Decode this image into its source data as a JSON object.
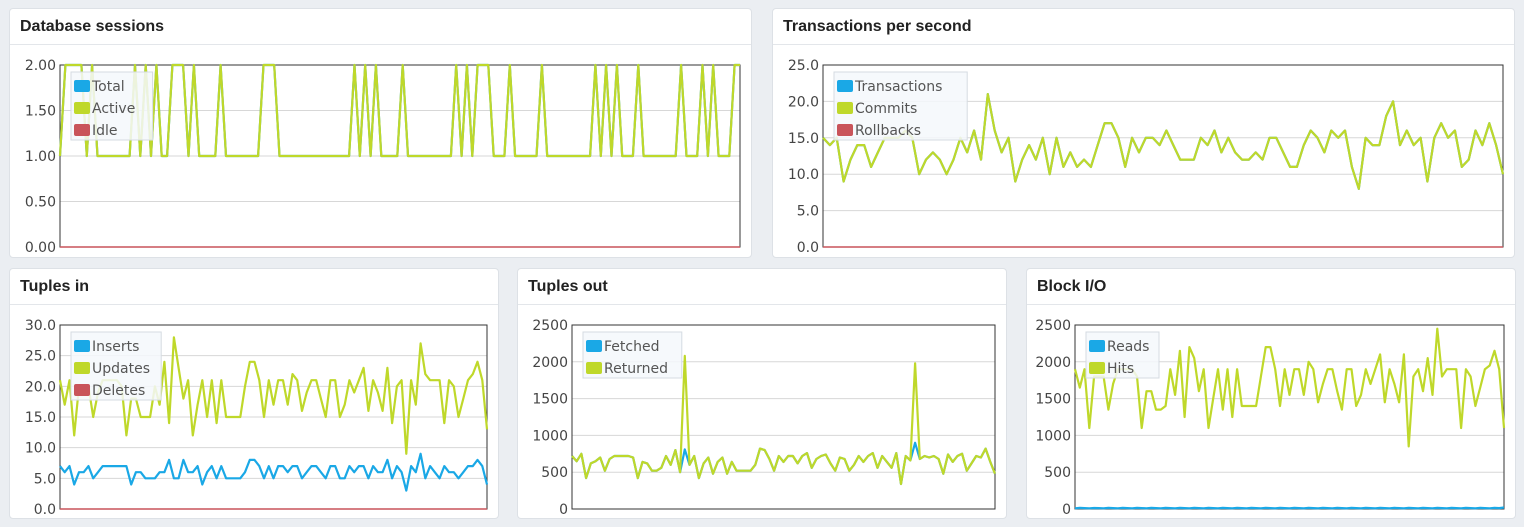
{
  "colors": {
    "blue": "#1aa8e6",
    "green": "#bfd82a",
    "red": "#c9545a",
    "grid": "#d7d7d7"
  },
  "chart_data": [
    {
      "id": "sessions",
      "type": "line",
      "title": "Database sessions",
      "ylim": [
        0,
        2
      ],
      "yticks": [
        "0.00",
        "0.50",
        "1.00",
        "1.50",
        "2.00"
      ],
      "ytick_values": [
        0,
        0.5,
        1,
        1.5,
        2
      ],
      "legend": "top-left",
      "grid": true,
      "series": [
        {
          "name": "Total",
          "color": "blue",
          "values": [
            1,
            2,
            2,
            2,
            2,
            1,
            2,
            1,
            1,
            1,
            1,
            1,
            1,
            1,
            2,
            1,
            2,
            1,
            2,
            1,
            1,
            2,
            2,
            2,
            1,
            2,
            1,
            1,
            1,
            1,
            2,
            1,
            1,
            1,
            1,
            1,
            1,
            1,
            2,
            2,
            2,
            1,
            1,
            1,
            1,
            1,
            1,
            1,
            1,
            1,
            1,
            1,
            1,
            1,
            1,
            2,
            1,
            2,
            1,
            2,
            1,
            1,
            1,
            1,
            2,
            1,
            1,
            1,
            1,
            1,
            1,
            1,
            1,
            1,
            2,
            1,
            2,
            1,
            2,
            2,
            2,
            1,
            1,
            1,
            2,
            1,
            1,
            1,
            1,
            1,
            2,
            1,
            1,
            1,
            1,
            1,
            1,
            1,
            1,
            1,
            2,
            1,
            2,
            1,
            2,
            1,
            1,
            1,
            2,
            1,
            1,
            1,
            1,
            1,
            1,
            1,
            2,
            1,
            1,
            1,
            2,
            1,
            2,
            1,
            1,
            1,
            2,
            2
          ]
        },
        {
          "name": "Active",
          "color": "green",
          "values": [
            1,
            2,
            2,
            2,
            2,
            1,
            2,
            1,
            1,
            1,
            1,
            1,
            1,
            1,
            2,
            1,
            2,
            1,
            2,
            1,
            1,
            2,
            2,
            2,
            1,
            2,
            1,
            1,
            1,
            1,
            2,
            1,
            1,
            1,
            1,
            1,
            1,
            1,
            2,
            2,
            2,
            1,
            1,
            1,
            1,
            1,
            1,
            1,
            1,
            1,
            1,
            1,
            1,
            1,
            1,
            2,
            1,
            2,
            1,
            2,
            1,
            1,
            1,
            1,
            2,
            1,
            1,
            1,
            1,
            1,
            1,
            1,
            1,
            1,
            2,
            1,
            2,
            1,
            2,
            2,
            2,
            1,
            1,
            1,
            2,
            1,
            1,
            1,
            1,
            1,
            2,
            1,
            1,
            1,
            1,
            1,
            1,
            1,
            1,
            1,
            2,
            1,
            2,
            1,
            2,
            1,
            1,
            1,
            2,
            1,
            1,
            1,
            1,
            1,
            1,
            1,
            2,
            1,
            1,
            1,
            2,
            1,
            2,
            1,
            1,
            1,
            2,
            2
          ]
        },
        {
          "name": "Idle",
          "color": "red",
          "values": [
            0,
            0
          ]
        }
      ]
    },
    {
      "id": "tps",
      "type": "line",
      "title": "Transactions per second",
      "ylim": [
        0,
        25
      ],
      "yticks": [
        "0.0",
        "5.0",
        "10.0",
        "15.0",
        "20.0",
        "25.0"
      ],
      "ytick_values": [
        0,
        5,
        10,
        15,
        20,
        25
      ],
      "legend": "top-left",
      "grid": true,
      "series": [
        {
          "name": "Transactions",
          "color": "blue",
          "values": [
            15,
            14,
            15,
            9,
            12,
            14,
            14,
            11,
            13,
            15,
            15,
            15,
            16,
            15,
            10,
            12,
            13,
            12,
            10,
            12,
            15,
            13,
            16,
            12,
            21,
            16,
            13,
            15,
            9,
            12,
            14,
            12,
            15,
            10,
            15,
            11,
            13,
            11,
            12,
            11,
            14,
            17,
            17,
            15,
            11,
            15,
            13,
            15,
            15,
            14,
            16,
            14,
            12,
            12,
            12,
            15,
            14,
            16,
            13,
            15,
            13,
            12,
            12,
            13,
            12,
            15,
            15,
            13,
            11,
            11,
            14,
            16,
            15,
            13,
            16,
            15,
            16,
            11,
            8,
            15,
            14,
            14,
            18,
            20,
            14,
            16,
            14,
            15,
            9,
            15,
            17,
            15,
            16,
            11,
            12,
            16,
            14,
            17,
            14,
            10
          ]
        },
        {
          "name": "Commits",
          "color": "green",
          "values": [
            15,
            14,
            15,
            9,
            12,
            14,
            14,
            11,
            13,
            15,
            15,
            15,
            16,
            15,
            10,
            12,
            13,
            12,
            10,
            12,
            15,
            13,
            16,
            12,
            21,
            16,
            13,
            15,
            9,
            12,
            14,
            12,
            15,
            10,
            15,
            11,
            13,
            11,
            12,
            11,
            14,
            17,
            17,
            15,
            11,
            15,
            13,
            15,
            15,
            14,
            16,
            14,
            12,
            12,
            12,
            15,
            14,
            16,
            13,
            15,
            13,
            12,
            12,
            13,
            12,
            15,
            15,
            13,
            11,
            11,
            14,
            16,
            15,
            13,
            16,
            15,
            16,
            11,
            8,
            15,
            14,
            14,
            18,
            20,
            14,
            16,
            14,
            15,
            9,
            15,
            17,
            15,
            16,
            11,
            12,
            16,
            14,
            17,
            14,
            10
          ]
        },
        {
          "name": "Rollbacks",
          "color": "red",
          "values": [
            0,
            0
          ]
        }
      ]
    },
    {
      "id": "tuplesin",
      "type": "line",
      "title": "Tuples in",
      "ylim": [
        0,
        30
      ],
      "yticks": [
        "0.0",
        "5.0",
        "10.0",
        "15.0",
        "20.0",
        "25.0",
        "30.0"
      ],
      "ytick_values": [
        0,
        5,
        10,
        15,
        20,
        25,
        30
      ],
      "legend": "top-left",
      "grid": true,
      "series": [
        {
          "name": "Inserts",
          "color": "blue",
          "values": [
            7,
            6,
            7,
            4,
            6,
            6,
            7,
            5,
            6,
            7,
            7,
            7,
            7,
            7,
            7,
            4,
            6,
            6,
            5,
            5,
            5,
            6,
            6,
            8,
            5,
            5,
            8,
            6,
            6,
            7,
            4,
            6,
            7,
            5,
            7,
            5,
            5,
            5,
            5,
            6,
            8,
            8,
            7,
            5,
            7,
            5,
            7,
            7,
            6,
            7,
            7,
            5,
            6,
            7,
            7,
            6,
            5,
            7,
            7,
            5,
            5,
            7,
            6,
            7,
            7,
            5,
            7,
            6,
            6,
            8,
            5,
            7,
            6,
            3,
            7,
            6,
            9,
            5,
            7,
            6,
            5,
            7,
            6,
            6,
            5,
            6,
            7,
            7,
            8,
            7,
            4
          ]
        },
        {
          "name": "Updates",
          "color": "green",
          "values": [
            21,
            17,
            21,
            12,
            20,
            20,
            20,
            15,
            19,
            21,
            21,
            21,
            21,
            20,
            12,
            18,
            18,
            15,
            15,
            15,
            20,
            17,
            24,
            14,
            28,
            23,
            18,
            21,
            12,
            17,
            21,
            15,
            21,
            14,
            21,
            15,
            15,
            15,
            15,
            20,
            24,
            24,
            21,
            15,
            21,
            17,
            21,
            21,
            17,
            22,
            21,
            16,
            19,
            21,
            21,
            18,
            15,
            21,
            21,
            15,
            17,
            21,
            19,
            21,
            23,
            16,
            21,
            19,
            16,
            23,
            14,
            20,
            21,
            9,
            21,
            17,
            27,
            22,
            21,
            21,
            21,
            14,
            21,
            20,
            15,
            18,
            21,
            22,
            24,
            21,
            13
          ]
        },
        {
          "name": "Deletes",
          "color": "red",
          "values": [
            0,
            0
          ]
        }
      ]
    },
    {
      "id": "tuplesout",
      "type": "line",
      "title": "Tuples out",
      "ylim": [
        0,
        2500
      ],
      "yticks": [
        "0",
        "500",
        "1000",
        "1500",
        "2000",
        "2500"
      ],
      "ytick_values": [
        0,
        500,
        1000,
        1500,
        2000,
        2500
      ],
      "legend": "top-left",
      "grid": true,
      "series": [
        {
          "name": "Fetched",
          "color": "blue",
          "values": [
            720,
            650,
            750,
            420,
            620,
            650,
            700,
            520,
            680,
            720,
            720,
            720,
            720,
            700,
            420,
            640,
            620,
            520,
            520,
            560,
            720,
            600,
            800,
            500,
            810,
            600,
            720,
            420,
            620,
            700,
            480,
            640,
            700,
            480,
            640,
            520,
            520,
            520,
            520,
            600,
            820,
            800,
            680,
            520,
            720,
            640,
            720,
            720,
            620,
            720,
            760,
            560,
            680,
            720,
            740,
            620,
            520,
            700,
            680,
            520,
            600,
            720,
            640,
            720,
            760,
            560,
            720,
            640,
            560,
            760,
            340,
            720,
            660,
            900,
            680,
            720,
            700,
            720,
            680,
            480,
            740,
            640,
            720,
            750,
            520,
            620,
            720,
            700,
            820,
            640,
            480
          ]
        },
        {
          "name": "Returned",
          "color": "green",
          "values": [
            720,
            650,
            750,
            420,
            620,
            650,
            700,
            520,
            680,
            720,
            720,
            720,
            720,
            700,
            420,
            640,
            620,
            520,
            520,
            560,
            720,
            600,
            800,
            500,
            2080,
            600,
            720,
            420,
            620,
            700,
            480,
            640,
            700,
            480,
            640,
            520,
            520,
            520,
            520,
            600,
            820,
            800,
            680,
            520,
            720,
            640,
            720,
            720,
            620,
            720,
            760,
            560,
            680,
            720,
            740,
            620,
            520,
            700,
            680,
            520,
            600,
            720,
            640,
            720,
            760,
            560,
            720,
            640,
            560,
            760,
            340,
            720,
            660,
            1980,
            680,
            720,
            700,
            720,
            680,
            480,
            740,
            640,
            720,
            750,
            520,
            620,
            720,
            700,
            820,
            640,
            480
          ]
        }
      ]
    },
    {
      "id": "blockio",
      "type": "line",
      "title": "Block I/O",
      "ylim": [
        0,
        2500
      ],
      "yticks": [
        "0",
        "500",
        "1000",
        "1500",
        "2000",
        "2500"
      ],
      "ytick_values": [
        0,
        500,
        1000,
        1500,
        2000,
        2500
      ],
      "legend": "top-left",
      "grid": true,
      "series": [
        {
          "name": "Reads",
          "color": "blue",
          "values": [
            10,
            15,
            12,
            10,
            14,
            12,
            10,
            15,
            12,
            10,
            15,
            12,
            10,
            15,
            12,
            10,
            15,
            12,
            10,
            15,
            12,
            10,
            15,
            12,
            10,
            15,
            12,
            10,
            15,
            12,
            10,
            15,
            12,
            10,
            15,
            12,
            10,
            15,
            12,
            10,
            15,
            12,
            10,
            15,
            12,
            10,
            15,
            12,
            10,
            15,
            12,
            10,
            15,
            12,
            10,
            15,
            12,
            10,
            15,
            12,
            10,
            15,
            12,
            10,
            15,
            12,
            10,
            15,
            12,
            10,
            15,
            12,
            10,
            15,
            12,
            10,
            15,
            12,
            10,
            15,
            12,
            10,
            15,
            12,
            10,
            15,
            12,
            10,
            15,
            12,
            20
          ]
        },
        {
          "name": "Hits",
          "color": "green",
          "values": [
            1900,
            1650,
            1900,
            1100,
            1800,
            1800,
            1800,
            1350,
            1700,
            1900,
            1900,
            1900,
            1900,
            1800,
            1100,
            1600,
            1600,
            1350,
            1350,
            1400,
            1900,
            1550,
            2150,
            1250,
            2200,
            2050,
            1600,
            1900,
            1100,
            1500,
            1900,
            1350,
            1900,
            1250,
            1900,
            1400,
            1400,
            1400,
            1400,
            1800,
            2200,
            2200,
            1900,
            1400,
            1900,
            1550,
            1900,
            1900,
            1550,
            2000,
            1900,
            1450,
            1700,
            1900,
            1900,
            1600,
            1350,
            1900,
            1900,
            1400,
            1550,
            1900,
            1700,
            1900,
            2100,
            1450,
            1900,
            1700,
            1450,
            2100,
            850,
            1800,
            1900,
            1600,
            2050,
            1550,
            2450,
            1800,
            1900,
            1900,
            1900,
            1100,
            1900,
            1800,
            1400,
            1650,
            1900,
            1950,
            2150,
            1900,
            1100
          ]
        }
      ]
    }
  ]
}
